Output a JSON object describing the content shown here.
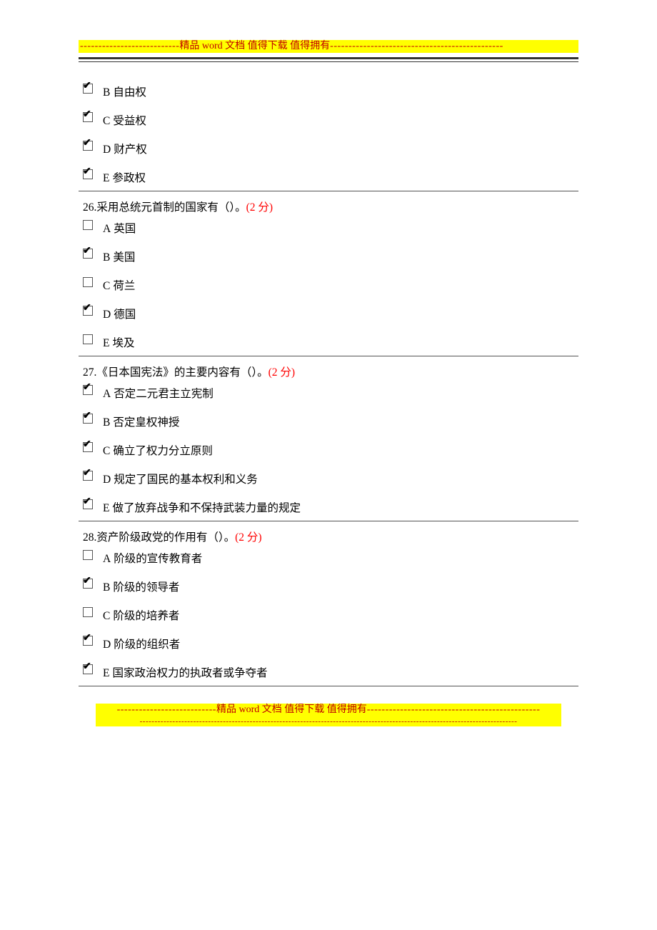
{
  "banners": {
    "top": {
      "left_dashes": "---------------------------",
      "prefix": "精品",
      "word": "word",
      "suffix": "文档   值得下载   值得拥有",
      "right_dashes": "-----------------------------------------------"
    },
    "bottom_line2": "-------------------------------------------------------------------------------------------------------------------------------"
  },
  "question_groups": [
    {
      "stem": null,
      "options": [
        {
          "letter": "B",
          "text": "自由权",
          "checked": true
        },
        {
          "letter": "C",
          "text": "受益权",
          "checked": true
        },
        {
          "letter": "D",
          "text": "财产权",
          "checked": true
        },
        {
          "letter": "E",
          "text": "参政权",
          "checked": true
        }
      ]
    },
    {
      "stem": {
        "num": "26.",
        "body": "采用总统元首制的国家有（）。",
        "points": "(2 分)"
      },
      "options": [
        {
          "letter": "A",
          "text": "英国",
          "checked": false
        },
        {
          "letter": "B",
          "text": "美国",
          "checked": true
        },
        {
          "letter": "C",
          "text": "荷兰",
          "checked": false
        },
        {
          "letter": "D",
          "text": "德国",
          "checked": true
        },
        {
          "letter": "E",
          "text": "埃及",
          "checked": false
        }
      ]
    },
    {
      "stem": {
        "num": "27.",
        "body": "《日本国宪法》的主要内容有（）。",
        "points": "(2 分)"
      },
      "options": [
        {
          "letter": "A",
          "text": "否定二元君主立宪制",
          "checked": true
        },
        {
          "letter": "B",
          "text": "否定皇权神授",
          "checked": true
        },
        {
          "letter": "C",
          "text": "确立了权力分立原则",
          "checked": true
        },
        {
          "letter": "D",
          "text": "规定了国民的基本权利和义务",
          "checked": true
        },
        {
          "letter": "E",
          "text": "做了放弃战争和不保持武装力量的规定",
          "checked": true
        }
      ]
    },
    {
      "stem": {
        "num": "28.",
        "body": "资产阶级政党的作用有（）。",
        "points": "(2 分)"
      },
      "options": [
        {
          "letter": "A",
          "text": "阶级的宣传教育者",
          "checked": false
        },
        {
          "letter": "B",
          "text": "阶级的领导者",
          "checked": true
        },
        {
          "letter": "C",
          "text": "阶级的培养者",
          "checked": false
        },
        {
          "letter": "D",
          "text": "阶级的组织者",
          "checked": true
        },
        {
          "letter": "E",
          "text": "国家政治权力的执政者或争夺者",
          "checked": true
        }
      ]
    }
  ]
}
